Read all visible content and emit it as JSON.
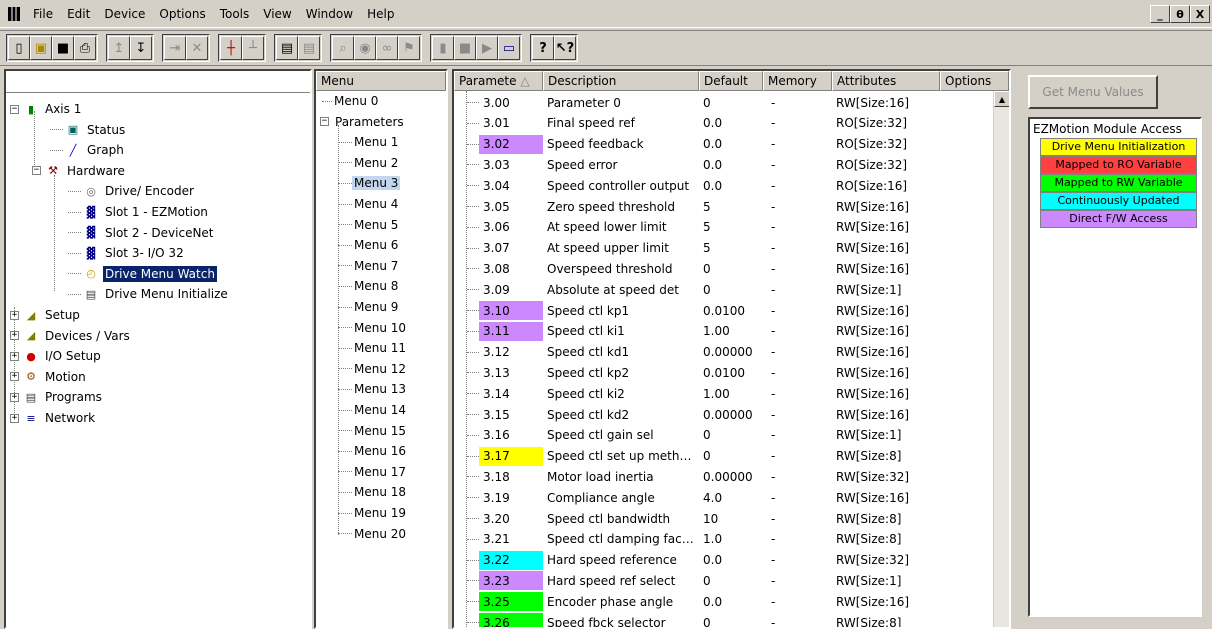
{
  "menubar": {
    "items": [
      "File",
      "Edit",
      "Device",
      "Options",
      "Tools",
      "View",
      "Window",
      "Help"
    ],
    "window_controls": [
      "_",
      "θ",
      "X"
    ]
  },
  "tree": {
    "items": [
      {
        "label": "Axis 1",
        "icon": "axis-icon",
        "expander": "−"
      },
      {
        "label": "Status",
        "icon": "status-icon"
      },
      {
        "label": "Graph",
        "icon": "graph-icon"
      },
      {
        "label": "Hardware",
        "icon": "hardware-icon",
        "expander": "−"
      },
      {
        "label": "Drive/ Encoder",
        "icon": "encoder-icon"
      },
      {
        "label": "Slot 1 - EZMotion",
        "icon": "slot-icon"
      },
      {
        "label": "Slot 2 - DeviceNet",
        "icon": "slot-icon"
      },
      {
        "label": "Slot 3- I/O 32",
        "icon": "slot-icon"
      },
      {
        "label": "Drive Menu Watch",
        "icon": "watch-icon",
        "selected": true
      },
      {
        "label": "Drive Menu Initialize",
        "icon": "initialize-icon"
      },
      {
        "label": "Setup",
        "icon": "setup-icon",
        "expander": "+"
      },
      {
        "label": "Devices / Vars",
        "icon": "devices-icon",
        "expander": "+"
      },
      {
        "label": "I/O Setup",
        "icon": "io-setup-icon",
        "expander": "+"
      },
      {
        "label": "Motion",
        "icon": "motion-icon",
        "expander": "+"
      },
      {
        "label": "Programs",
        "icon": "programs-icon",
        "expander": "+"
      },
      {
        "label": "Network",
        "icon": "network-icon",
        "expander": "+"
      }
    ]
  },
  "menu_panel": {
    "header": "Menu",
    "items": [
      "Menu 0",
      "Parameters",
      "Menu 1",
      "Menu 2",
      "Menu 3",
      "Menu 4",
      "Menu 5",
      "Menu 6",
      "Menu 7",
      "Menu 8",
      "Menu 9",
      "Menu 10",
      "Menu 11",
      "Menu 12",
      "Menu 13",
      "Menu 14",
      "Menu 15",
      "Menu 16",
      "Menu 17",
      "Menu 18",
      "Menu 19",
      "Menu 20"
    ],
    "selected": "Menu 3"
  },
  "param_table": {
    "headers": [
      "Paramete",
      "Description",
      "Default",
      "Memory",
      "Attributes",
      "Options"
    ],
    "sort_indicator": "△",
    "rows": [
      {
        "num": "3.00",
        "desc": "Parameter 0",
        "default": "0",
        "memory": "-",
        "attr": "RW[Size:16]",
        "hl": ""
      },
      {
        "num": "3.01",
        "desc": "Final speed ref",
        "default": "0.0",
        "memory": "-",
        "attr": "RO[Size:32]",
        "hl": ""
      },
      {
        "num": "3.02",
        "desc": "Speed feedback",
        "default": "0.0",
        "memory": "-",
        "attr": "RO[Size:32]",
        "hl": "#cc88ff"
      },
      {
        "num": "3.03",
        "desc": "Speed error",
        "default": "0.0",
        "memory": "-",
        "attr": "RO[Size:32]",
        "hl": ""
      },
      {
        "num": "3.04",
        "desc": "Speed controller output",
        "default": "0.0",
        "memory": "-",
        "attr": "RO[Size:16]",
        "hl": ""
      },
      {
        "num": "3.05",
        "desc": "Zero speed threshold",
        "default": "5",
        "memory": "-",
        "attr": "RW[Size:16]",
        "hl": ""
      },
      {
        "num": "3.06",
        "desc": "At speed lower limit",
        "default": "5",
        "memory": "-",
        "attr": "RW[Size:16]",
        "hl": ""
      },
      {
        "num": "3.07",
        "desc": "At speed upper limit",
        "default": "5",
        "memory": "-",
        "attr": "RW[Size:16]",
        "hl": ""
      },
      {
        "num": "3.08",
        "desc": "Overspeed threshold",
        "default": "0",
        "memory": "-",
        "attr": "RW[Size:16]",
        "hl": ""
      },
      {
        "num": "3.09",
        "desc": "Absolute at speed det",
        "default": "0",
        "memory": "-",
        "attr": "RW[Size:1]",
        "hl": ""
      },
      {
        "num": "3.10",
        "desc": "Speed ctl kp1",
        "default": "0.0100",
        "memory": "-",
        "attr": "RW[Size:16]",
        "hl": "#cc88ff"
      },
      {
        "num": "3.11",
        "desc": "Speed ctl ki1",
        "default": "1.00",
        "memory": "-",
        "attr": "RW[Size:16]",
        "hl": "#cc88ff"
      },
      {
        "num": "3.12",
        "desc": "Speed ctl kd1",
        "default": "0.00000",
        "memory": "-",
        "attr": "RW[Size:16]",
        "hl": ""
      },
      {
        "num": "3.13",
        "desc": "Speed ctl kp2",
        "default": "0.0100",
        "memory": "-",
        "attr": "RW[Size:16]",
        "hl": ""
      },
      {
        "num": "3.14",
        "desc": "Speed ctl ki2",
        "default": "1.00",
        "memory": "-",
        "attr": "RW[Size:16]",
        "hl": ""
      },
      {
        "num": "3.15",
        "desc": "Speed ctl kd2",
        "default": "0.00000",
        "memory": "-",
        "attr": "RW[Size:16]",
        "hl": ""
      },
      {
        "num": "3.16",
        "desc": "Speed ctl gain sel",
        "default": "0",
        "memory": "-",
        "attr": "RW[Size:1]",
        "hl": ""
      },
      {
        "num": "3.17",
        "desc": "Speed ctl set up meth…",
        "default": "0",
        "memory": "-",
        "attr": "RW[Size:8]",
        "hl": "#ffff00"
      },
      {
        "num": "3.18",
        "desc": "Motor load inertia",
        "default": "0.00000",
        "memory": "-",
        "attr": "RW[Size:32]",
        "hl": ""
      },
      {
        "num": "3.19",
        "desc": "Compliance angle",
        "default": "4.0",
        "memory": "-",
        "attr": "RW[Size:16]",
        "hl": ""
      },
      {
        "num": "3.20",
        "desc": "Speed ctl bandwidth",
        "default": "10",
        "memory": "-",
        "attr": "RW[Size:8]",
        "hl": ""
      },
      {
        "num": "3.21",
        "desc": "Speed ctl damping fac…",
        "default": "1.0",
        "memory": "-",
        "attr": "RW[Size:8]",
        "hl": ""
      },
      {
        "num": "3.22",
        "desc": "Hard speed reference",
        "default": "0.0",
        "memory": "-",
        "attr": "RW[Size:32]",
        "hl": "#00ffff"
      },
      {
        "num": "3.23",
        "desc": "Hard speed ref select",
        "default": "0",
        "memory": "-",
        "attr": "RW[Size:1]",
        "hl": "#cc88ff"
      },
      {
        "num": "3.25",
        "desc": "Encoder phase angle",
        "default": "0.0",
        "memory": "-",
        "attr": "RW[Size:16]",
        "hl": "#00ff00"
      },
      {
        "num": "3.26",
        "desc": "Speed fbck selector",
        "default": "0",
        "memory": "-",
        "attr": "RW[Size:8]",
        "hl": "#00ff00"
      }
    ]
  },
  "right_panel": {
    "get_menu_button": "Get Menu Values",
    "legend_title": "EZMotion Module Access",
    "legend_items": [
      {
        "label": "Drive Menu Initialization",
        "color": "#ffff00"
      },
      {
        "label": "Mapped to RO Variable",
        "color": "#ff4040"
      },
      {
        "label": "Mapped to RW Variable",
        "color": "#00ff00"
      },
      {
        "label": "Continuously Updated",
        "color": "#00ffff"
      },
      {
        "label": "Direct F/W Access",
        "color": "#cc88ff"
      }
    ]
  }
}
